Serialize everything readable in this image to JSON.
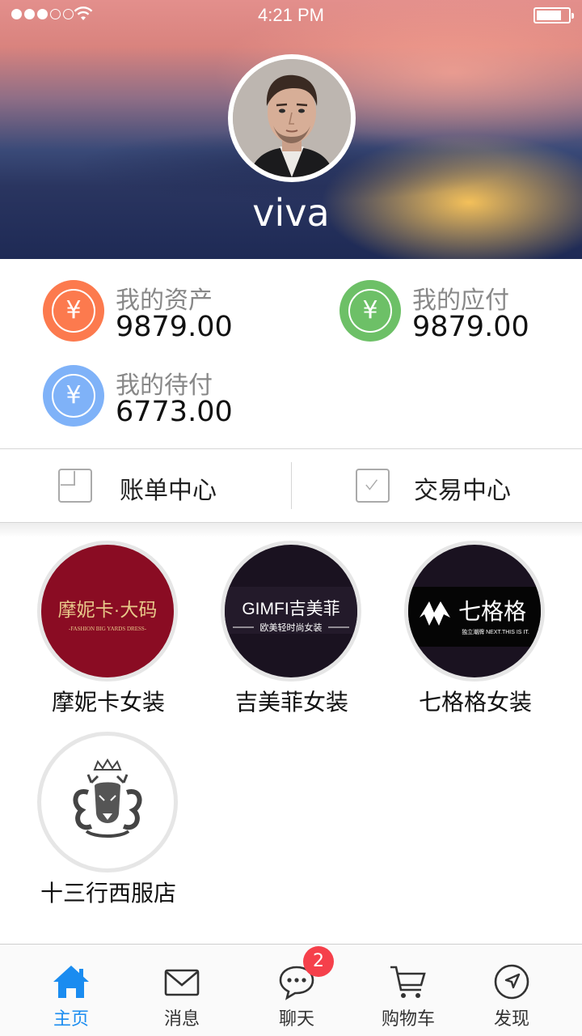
{
  "status_bar": {
    "time": "4:21 PM",
    "signal_bars_filled": 3,
    "signal_bars_total": 5,
    "battery_level": 0.75
  },
  "profile": {
    "username": "viva",
    "avatar_icon": "person-avatar"
  },
  "assets": [
    {
      "label": "我的资产",
      "value": "9879.00",
      "icon": "yuan-icon",
      "color": "#fc7a4e"
    },
    {
      "label": "我的应付",
      "value": "9879.00",
      "icon": "yuan-icon",
      "color": "#6dc067"
    },
    {
      "label": "我的待付",
      "value": "6773.00",
      "icon": "yuan-icon",
      "color": "#7fb2f8"
    }
  ],
  "centers": [
    {
      "label": "账单中心",
      "icon": "bill-icon"
    },
    {
      "label": "交易中心",
      "icon": "checkbox-icon"
    }
  ],
  "shops": [
    {
      "name": "摩妮卡女装",
      "logo_text": "摩妮卡·大码",
      "logo_subtext": "-FASHION BIG YARDS DRESS-",
      "logo_bg": "#8a0c23",
      "logo_color": "#e8c98a"
    },
    {
      "name": "吉美菲女装",
      "logo_text": "GIMFI吉美菲",
      "logo_subtext": "欧美轻时尚女装",
      "logo_bg": "#1a1220",
      "logo_color": "#ffffff"
    },
    {
      "name": "七格格女装",
      "logo_text": "七格格",
      "logo_subtext": "独立潮牌 NEXT.THIS IS IT.",
      "logo_bg": "#050505",
      "logo_color": "#ffffff"
    },
    {
      "name": "十三行西服店",
      "logo_text": "",
      "logo_subtext": "",
      "logo_bg": "#ffffff",
      "logo_color": "#444444"
    }
  ],
  "tabbar": {
    "tabs": [
      {
        "label": "主页",
        "icon": "home-icon",
        "active": true
      },
      {
        "label": "消息",
        "icon": "mail-icon",
        "active": false
      },
      {
        "label": "聊天",
        "icon": "chat-icon",
        "active": false,
        "badge": "2"
      },
      {
        "label": "购物车",
        "icon": "cart-icon",
        "active": false
      },
      {
        "label": "发现",
        "icon": "compass-icon",
        "active": false
      }
    ]
  },
  "colors": {
    "accent": "#1a8cf0",
    "badge": "#f5404b"
  }
}
